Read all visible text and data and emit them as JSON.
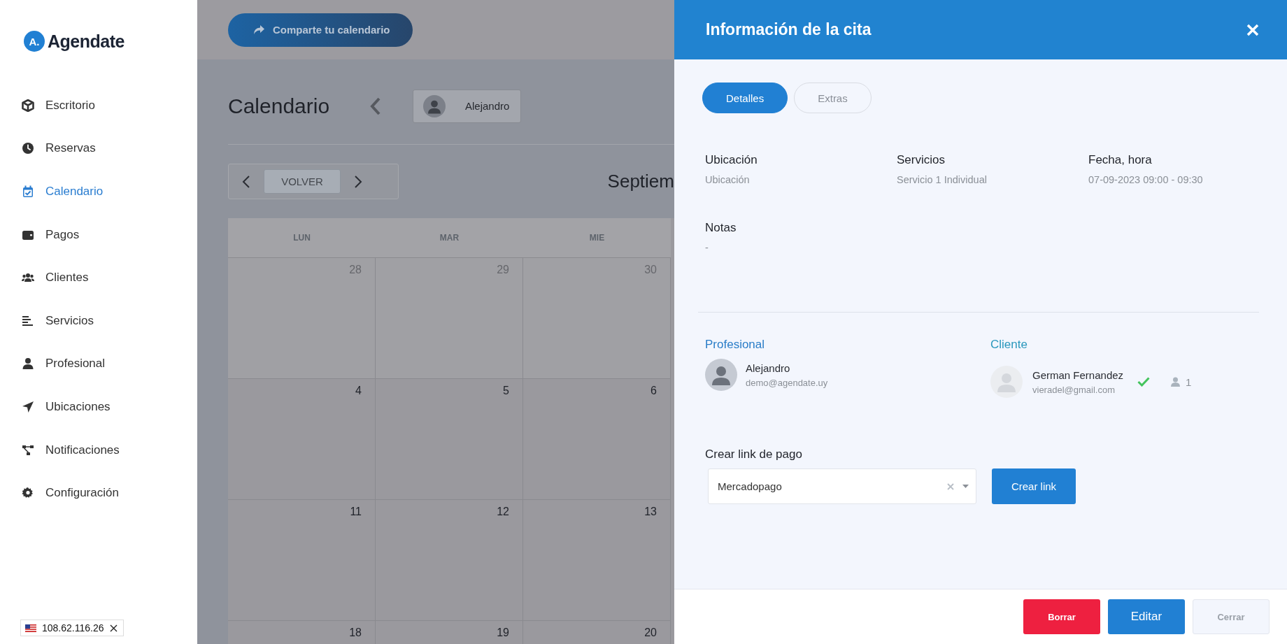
{
  "sidebar": {
    "logo": {
      "mark": "A.",
      "name": "Agendate"
    },
    "items": [
      {
        "label": "Escritorio",
        "selected": false
      },
      {
        "label": "Reservas",
        "selected": false
      },
      {
        "label": "Calendario",
        "selected": true
      },
      {
        "label": "Pagos",
        "selected": false
      },
      {
        "label": "Clientes",
        "selected": false
      },
      {
        "label": "Servicios",
        "selected": false
      },
      {
        "label": "Profesional",
        "selected": false
      },
      {
        "label": "Ubicaciones",
        "selected": false
      },
      {
        "label": "Notificaciones",
        "selected": false
      },
      {
        "label": "Configuración",
        "selected": false
      }
    ],
    "ip_badge": "108.62.116.26"
  },
  "toolbar": {
    "share_button": "Comparte tu calendario"
  },
  "calendar": {
    "title": "Calendario",
    "professional": "Alejandro",
    "today_button": "VOLVER",
    "month": "Septiem",
    "weekdays": [
      "LUN",
      "MAR",
      "MIE"
    ],
    "weeks": [
      [
        {
          "day": "28",
          "other_month": true
        },
        {
          "day": "29",
          "other_month": true
        },
        {
          "day": "30",
          "other_month": true
        }
      ],
      [
        {
          "day": "4",
          "other_month": false
        },
        {
          "day": "5",
          "other_month": false
        },
        {
          "day": "6",
          "other_month": false
        }
      ],
      [
        {
          "day": "11",
          "other_month": false
        },
        {
          "day": "12",
          "other_month": false
        },
        {
          "day": "13",
          "other_month": false
        }
      ],
      [
        {
          "day": "18",
          "other_month": false
        },
        {
          "day": "19",
          "other_month": false
        },
        {
          "day": "20",
          "other_month": false
        }
      ]
    ]
  },
  "panel": {
    "title": "Información de la cita",
    "tabs": [
      {
        "label": "Detalles",
        "selected": true
      },
      {
        "label": "Extras",
        "selected": false
      }
    ],
    "details": [
      {
        "label": "Ubicación",
        "value": "Ubicación"
      },
      {
        "label": "Servicios",
        "value": "Servicio 1 Individual"
      },
      {
        "label": "Fecha, hora",
        "value": "07-09-2023 09:00 - 09:30"
      }
    ],
    "notes": {
      "label": "Notas",
      "value": "-"
    },
    "professional": {
      "heading": "Profesional",
      "name": "Alejandro",
      "email": "demo@agendate.uy"
    },
    "client": {
      "heading": "Cliente",
      "name": "German Fernandez",
      "email": "vieradel@gmail.com",
      "confirmed": true,
      "count": "1"
    },
    "payment_link": {
      "label": "Crear link de pago",
      "select": {
        "value": "Mercadopago"
      },
      "button": "Crear link"
    },
    "footer_buttons": [
      {
        "label": "Borrar",
        "kind": "danger"
      },
      {
        "label": "Editar",
        "kind": "primary"
      },
      {
        "label": "Cerrar",
        "kind": "muted"
      }
    ]
  }
}
